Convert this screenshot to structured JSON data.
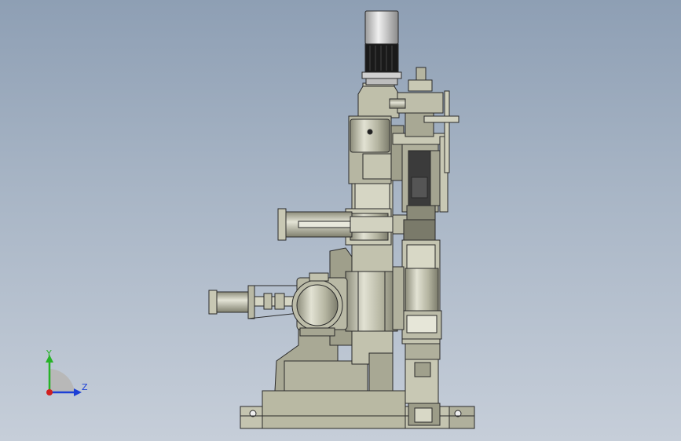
{
  "view": {
    "triad": {
      "y_label": "Y",
      "z_label": "Z",
      "colors": {
        "y": "#27b327",
        "z": "#1c3fd6",
        "x": "#d11f1f"
      }
    },
    "colors": {
      "body": "#b9b9a3",
      "body_light": "#d3d3c0",
      "body_dark": "#8f8f7c",
      "outline": "#2a2a2a",
      "motor_dark": "#1a1a1a",
      "metal": "#c9c9c9"
    }
  }
}
